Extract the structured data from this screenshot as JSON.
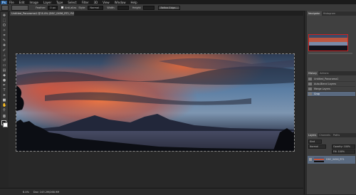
{
  "menu": {
    "logo": "Ps",
    "items": [
      "File",
      "Edit",
      "Image",
      "Layer",
      "Type",
      "Select",
      "Filter",
      "3D",
      "View",
      "Window",
      "Help"
    ]
  },
  "options": {
    "style_value": "Normal",
    "feather_label": "Feather:",
    "feather_value": "0 px",
    "antialias_label": "Anti-alias",
    "width_label": "Width:",
    "height_label": "Height:",
    "refine_label": "Refine Edge..."
  },
  "document": {
    "tab_title": "Untitled_Panorama1 @ 8.4% (DSC_0456_RT1, RGB/8)"
  },
  "status": {
    "zoom": "8.4%",
    "doc_size": "Doc: 243.2M/268.9M"
  },
  "panels": {
    "navigator_tabs": [
      "Navigator",
      "Histogram"
    ],
    "history_tabs": [
      "History",
      "Actions"
    ],
    "history_items": [
      "Untitled_Panorama1",
      "Auto-Blend Layers",
      "Merge Layers",
      "Crop"
    ],
    "layers_tabs": [
      "Layers",
      "Channels",
      "Paths"
    ],
    "layers_kind": "Kind",
    "layers_blend": "Normal",
    "layers_opacity": "Opacity: 100%",
    "layers_fill": "Fill: 100%",
    "layer_name": "DSC_0456_RT1"
  },
  "colors": {
    "menu_bg": "#1b1b1b",
    "panel_bg": "#404040",
    "canvas_bg": "#282828",
    "selection": "#5a6a80"
  }
}
